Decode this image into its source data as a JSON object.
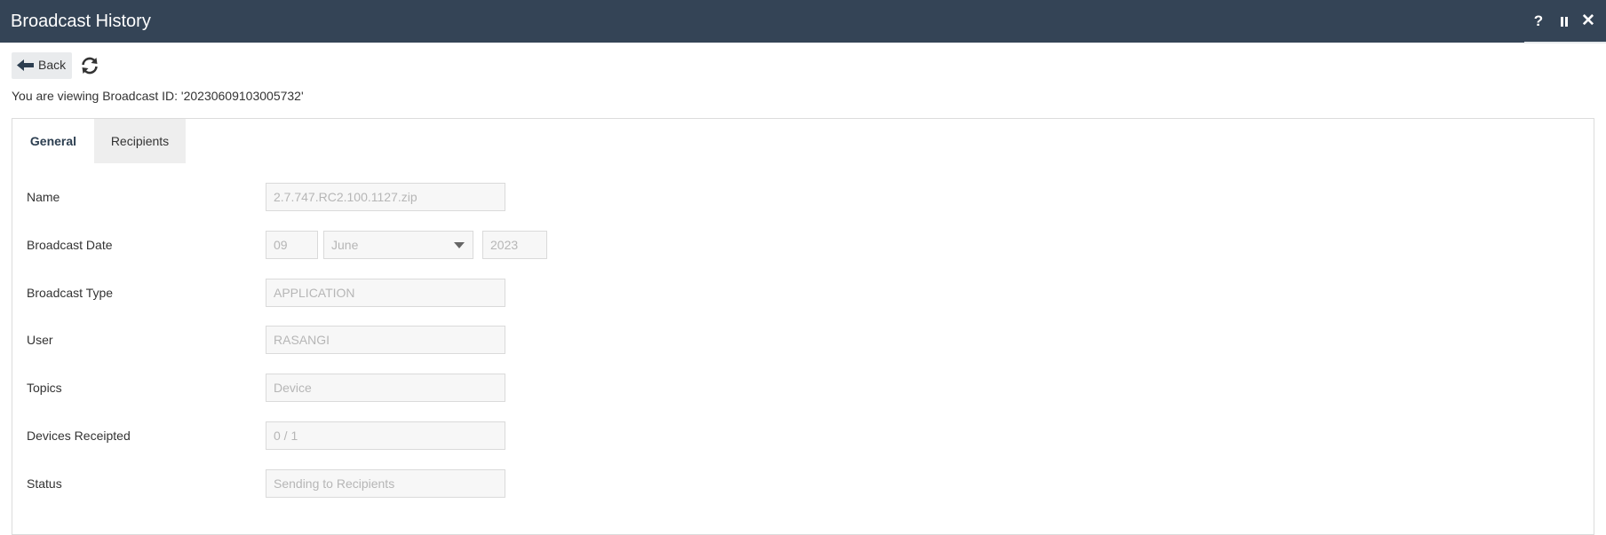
{
  "window": {
    "title": "Broadcast History",
    "help_label": "?",
    "close_label": "✕"
  },
  "toolbar": {
    "back_label": "Back"
  },
  "viewing_text": "You are viewing Broadcast ID: '20230609103005732'",
  "tabs": {
    "general": "General",
    "recipients": "Recipients"
  },
  "form": {
    "name": {
      "label": "Name",
      "value": "2.7.747.RC2.100.1127.zip"
    },
    "broadcast_date": {
      "label": "Broadcast Date",
      "day": "09",
      "month": "June",
      "year": "2023"
    },
    "broadcast_type": {
      "label": "Broadcast Type",
      "value": "APPLICATION"
    },
    "user": {
      "label": "User",
      "value": "RASANGI"
    },
    "topics": {
      "label": "Topics",
      "value": "Device"
    },
    "devices_receipted": {
      "label": "Devices Receipted",
      "value": "0 / 1"
    },
    "status": {
      "label": "Status",
      "value": "Sending to Recipients"
    }
  },
  "colors": {
    "titlebar": "#344456",
    "panel_border": "#dcdcdc",
    "field_bg": "#f7f7f7",
    "field_text": "#b6b6b6"
  }
}
